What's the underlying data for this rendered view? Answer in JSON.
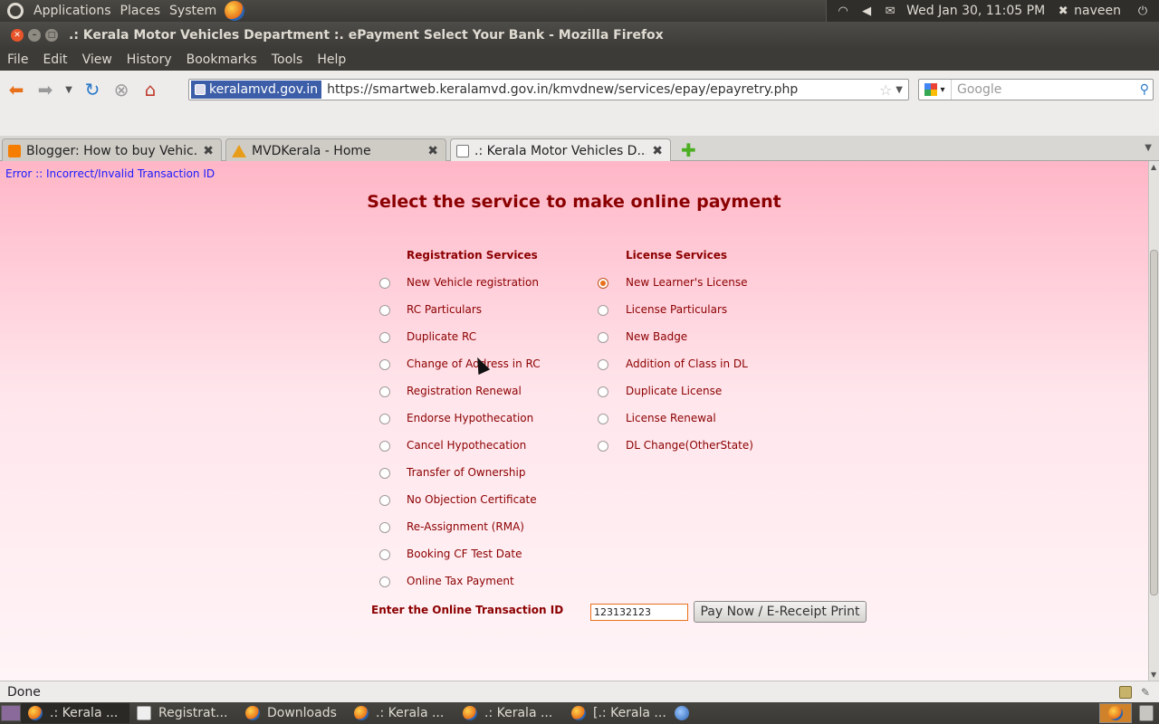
{
  "top_panel": {
    "menus": [
      "Applications",
      "Places",
      "System"
    ],
    "datetime": "Wed Jan 30, 11:05 PM",
    "user": "naveen"
  },
  "window": {
    "title": ".: Kerala Motor Vehicles Department :. ePayment Select Your Bank - Mozilla Firefox"
  },
  "menubar": [
    "File",
    "Edit",
    "View",
    "History",
    "Bookmarks",
    "Tools",
    "Help"
  ],
  "navbar": {
    "site_identity": "keralamvd.gov.in",
    "url": "https://smartweb.keralamvd.gov.in/kmvdnew/services/epay/epayretry.php",
    "search_placeholder": "Google"
  },
  "tabs": [
    {
      "label": "Blogger: How to buy Vehic...",
      "favicon": "blogger-icon",
      "active": false
    },
    {
      "label": "MVDKerala - Home",
      "favicon": "warning-icon",
      "active": false
    },
    {
      "label": ".: Kerala Motor Vehicles D...",
      "favicon": "page-icon",
      "active": true
    }
  ],
  "page": {
    "error": "Error :: Incorrect/Invalid Transaction ID",
    "heading": "Select the service to make online payment",
    "registration_header": "Registration Services",
    "license_header": "License Services",
    "registration_services": [
      {
        "label": "New Vehicle registration",
        "checked": false
      },
      {
        "label": "RC Particulars",
        "checked": false
      },
      {
        "label": "Duplicate RC",
        "checked": false
      },
      {
        "label": "Change of Address in RC",
        "checked": false
      },
      {
        "label": "Registration Renewal",
        "checked": false
      },
      {
        "label": "Endorse Hypothecation",
        "checked": false
      },
      {
        "label": "Cancel Hypothecation",
        "checked": false
      },
      {
        "label": "Transfer of Ownership",
        "checked": false
      },
      {
        "label": "No Objection Certificate",
        "checked": false
      },
      {
        "label": "Re-Assignment (RMA)",
        "checked": false
      },
      {
        "label": "Booking CF Test Date",
        "checked": false
      },
      {
        "label": "Online Tax Payment",
        "checked": false
      }
    ],
    "license_services": [
      {
        "label": "New Learner's License",
        "checked": true
      },
      {
        "label": "License Particulars",
        "checked": false
      },
      {
        "label": "New Badge",
        "checked": false
      },
      {
        "label": "Addition of Class in DL",
        "checked": false
      },
      {
        "label": "Duplicate License",
        "checked": false
      },
      {
        "label": "License Renewal",
        "checked": false
      },
      {
        "label": "DL Change(OtherState)",
        "checked": false
      }
    ],
    "transaction_label": "Enter the Online Transaction ID",
    "transaction_value": "123132123",
    "pay_button": "Pay Now / E-Receipt Print"
  },
  "statusbar": {
    "status": "Done"
  },
  "taskbar": [
    {
      "label": ".: Kerala ...",
      "icon": "firefox-icon",
      "active": true
    },
    {
      "label": "Registrat...",
      "icon": "document-icon",
      "active": false
    },
    {
      "label": "Downloads",
      "icon": "firefox-icon",
      "active": false
    },
    {
      "label": ".: Kerala ...",
      "icon": "firefox-icon",
      "active": false
    },
    {
      "label": ".: Kerala ...",
      "icon": "firefox-icon",
      "active": false
    },
    {
      "label": "[.: Kerala ...",
      "icon": "firefox-icon",
      "active": false
    }
  ]
}
